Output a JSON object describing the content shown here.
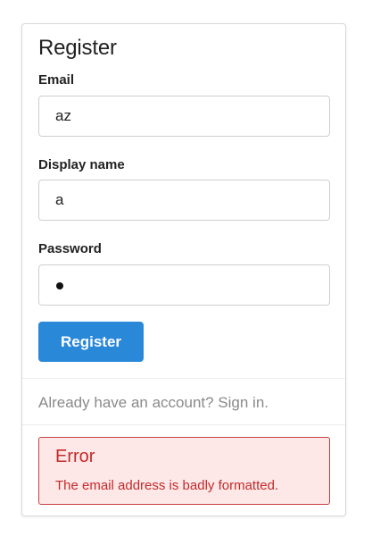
{
  "form": {
    "title": "Register",
    "email": {
      "label": "Email",
      "value": "az"
    },
    "display_name": {
      "label": "Display name",
      "value": "a"
    },
    "password": {
      "label": "Password",
      "value": "•"
    },
    "submit_label": "Register"
  },
  "signin_link": "Already have an account? Sign in.",
  "error": {
    "title": "Error",
    "message": "The email address is badly formatted."
  },
  "colors": {
    "primary_button": "#2a88d8",
    "error_text": "#c42b2b",
    "error_bg": "#fde7e7",
    "error_border": "#c94040"
  }
}
